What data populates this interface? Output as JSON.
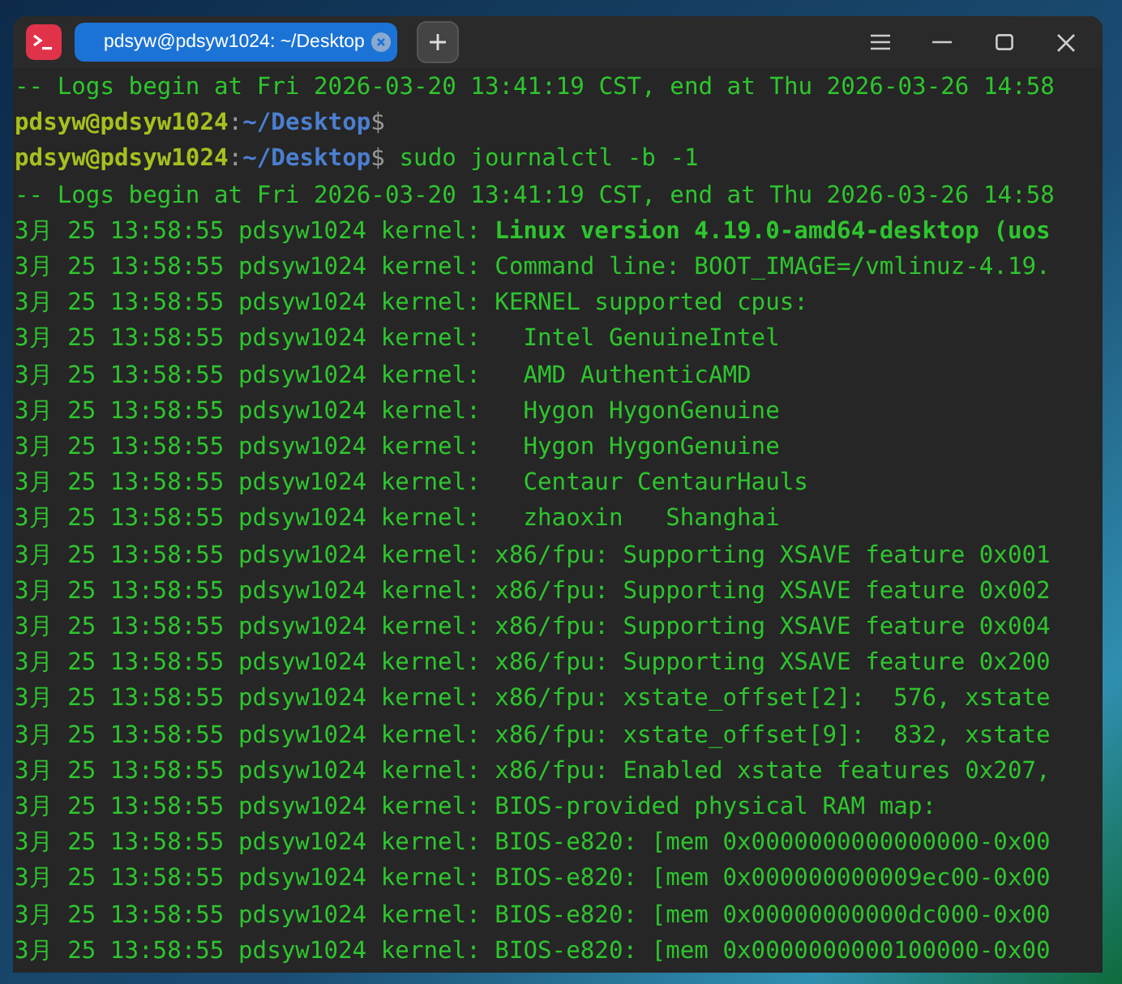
{
  "tabs": [
    {
      "label": "pdsyw@pdsyw1024: ~/Desktop",
      "selected": true
    }
  ],
  "lines": [
    {
      "kind": "plain",
      "text": "-- Logs begin at Fri 2026-03-20 13:41:19 CST, end at Thu 2026-03-26 14:58"
    },
    {
      "kind": "prompt",
      "user": "pdsyw@pdsyw1024",
      "sep": ":",
      "path": "~/Desktop",
      "symbol": "$"
    },
    {
      "kind": "prompt",
      "user": "pdsyw@pdsyw1024",
      "sep": ":",
      "path": "~/Desktop",
      "symbol": "$",
      "command": " sudo journalctl -b -1"
    },
    {
      "kind": "plain",
      "text": "-- Logs begin at Fri 2026-03-20 13:41:19 CST, end at Thu 2026-03-26 14:58"
    },
    {
      "kind": "plain",
      "text": "3月 25 13:58:55 pdsyw1024 kernel: **Linux version 4.19.0-amd64-desktop (uos**"
    },
    {
      "kind": "plain",
      "text": "3月 25 13:58:55 pdsyw1024 kernel: Command line: BOOT_IMAGE=/vmlinuz-4.19."
    },
    {
      "kind": "plain",
      "text": "3月 25 13:58:55 pdsyw1024 kernel: KERNEL supported cpus:"
    },
    {
      "kind": "plain",
      "text": "3月 25 13:58:55 pdsyw1024 kernel:   Intel GenuineIntel"
    },
    {
      "kind": "plain",
      "text": "3月 25 13:58:55 pdsyw1024 kernel:   AMD AuthenticAMD"
    },
    {
      "kind": "plain",
      "text": "3月 25 13:58:55 pdsyw1024 kernel:   Hygon HygonGenuine"
    },
    {
      "kind": "plain",
      "text": "3月 25 13:58:55 pdsyw1024 kernel:   Hygon HygonGenuine"
    },
    {
      "kind": "plain",
      "text": "3月 25 13:58:55 pdsyw1024 kernel:   Centaur CentaurHauls"
    },
    {
      "kind": "plain",
      "text": "3月 25 13:58:55 pdsyw1024 kernel:   zhaoxin   Shanghai"
    },
    {
      "kind": "plain",
      "text": "3月 25 13:58:55 pdsyw1024 kernel: x86/fpu: Supporting XSAVE feature 0x001"
    },
    {
      "kind": "plain",
      "text": "3月 25 13:58:55 pdsyw1024 kernel: x86/fpu: Supporting XSAVE feature 0x002"
    },
    {
      "kind": "plain",
      "text": "3月 25 13:58:55 pdsyw1024 kernel: x86/fpu: Supporting XSAVE feature 0x004"
    },
    {
      "kind": "plain",
      "text": "3月 25 13:58:55 pdsyw1024 kernel: x86/fpu: Supporting XSAVE feature 0x200"
    },
    {
      "kind": "plain",
      "text": "3月 25 13:58:55 pdsyw1024 kernel: x86/fpu: xstate_offset[2]:  576, xstate"
    },
    {
      "kind": "plain",
      "text": "3月 25 13:58:55 pdsyw1024 kernel: x86/fpu: xstate_offset[9]:  832, xstate"
    },
    {
      "kind": "plain",
      "text": "3月 25 13:58:55 pdsyw1024 kernel: x86/fpu: Enabled xstate features 0x207,"
    },
    {
      "kind": "plain",
      "text": "3月 25 13:58:55 pdsyw1024 kernel: BIOS-provided physical RAM map:"
    },
    {
      "kind": "plain",
      "text": "3月 25 13:58:55 pdsyw1024 kernel: BIOS-e820: [mem 0x0000000000000000-0x00"
    },
    {
      "kind": "plain",
      "text": "3月 25 13:58:55 pdsyw1024 kernel: BIOS-e820: [mem 0x000000000009ec00-0x00"
    },
    {
      "kind": "plain",
      "text": "3月 25 13:58:55 pdsyw1024 kernel: BIOS-e820: [mem 0x00000000000dc000-0x00"
    },
    {
      "kind": "plain",
      "text": "3月 25 13:58:55 pdsyw1024 kernel: BIOS-e820: [mem 0x0000000000100000-0x00"
    }
  ]
}
